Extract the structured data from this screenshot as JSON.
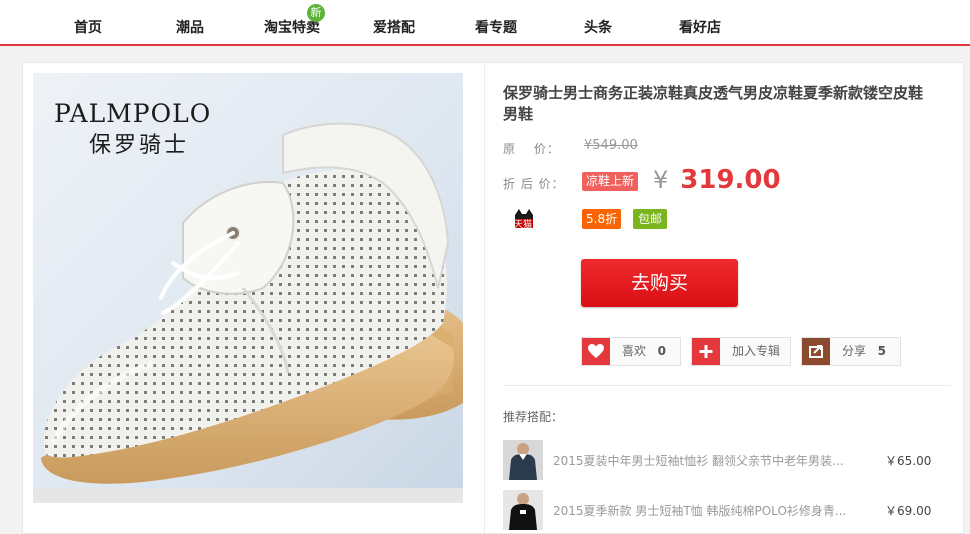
{
  "nav": {
    "items": [
      "首页",
      "潮品",
      "淘宝特卖",
      "爱搭配",
      "看专题",
      "头条",
      "看好店"
    ],
    "new_badge": "新",
    "accent_color": "#e4393c"
  },
  "product": {
    "brand_en": "PALMPOLO",
    "brand_cn": "保罗骑士",
    "title": "保罗骑士男士商务正装凉鞋真皮透气男皮凉鞋夏季新款镂空皮鞋男鞋",
    "original_label": "原　 价：",
    "original_price": "¥549.00",
    "sale_label": "折 后 价：",
    "promo_badge": "凉鞋上新",
    "currency": "¥",
    "sale_price": "319.00",
    "tmall_label": "天猫",
    "discount_badge": "5.8折",
    "shipping_badge": "包邮",
    "buy_label": "去购买"
  },
  "actions": {
    "like": {
      "label": "喜欢",
      "count": "0",
      "icon": "heart-icon",
      "color": "#e4393c"
    },
    "album": {
      "label": "加入专辑",
      "icon": "plus-icon",
      "color": "#e4393c"
    },
    "share": {
      "label": "分享",
      "count": "5",
      "icon": "share-icon",
      "color": "#8c4a2f"
    }
  },
  "recommend": {
    "title": "推荐搭配：",
    "items": [
      {
        "name": "2015夏装中年男士短袖t恤衫 翻领父亲节中老年男装...",
        "price": "￥65.00"
      },
      {
        "name": "2015夏季新款 男士短袖T恤 韩版纯棉POLO衫修身青...",
        "price": "￥69.00"
      }
    ]
  }
}
